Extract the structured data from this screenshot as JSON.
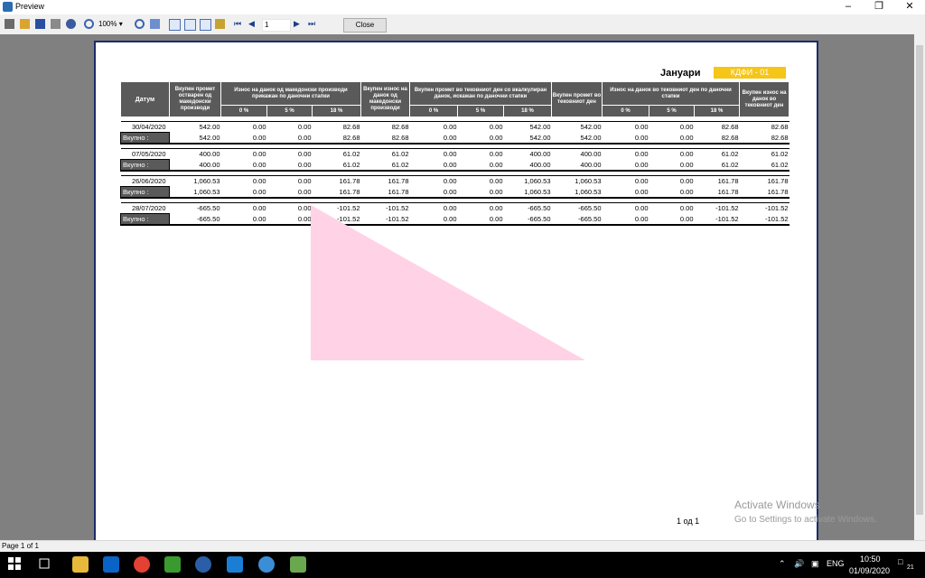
{
  "window": {
    "title": "Preview"
  },
  "toolbar": {
    "zoom": "100%",
    "page_input": "1",
    "close_label": "Close"
  },
  "report": {
    "title": "Јануари",
    "code": "КДФИ - 01",
    "headers": {
      "date": "Датум",
      "total_purchase": "Вкупен промет остварен од македонски производи",
      "vat_mk": "Износ на данок од македонски производи прикажан по даночни стапки",
      "total_tax_mk": "Вкупен износ на данок од македонски производи",
      "turnover_current": "Вкупен промет во тековниот ден со вкалкулиран данок, искажан по даночни стапки",
      "total_current": "Вкупен промет во тековниот ден",
      "vat_current": "Износ на данок во тековниот ден по даночни стапки",
      "total_tax_current": "Вкупен износ на данок во тековниот ден",
      "rate0": "0 %",
      "rate5": "5 %",
      "rate18": "18 %"
    },
    "total_label": "Вкупно :",
    "groups": [
      {
        "date": "30/04/2020",
        "row": [
          "542.00",
          "0.00",
          "0.00",
          "82.68",
          "82.68",
          "0.00",
          "0.00",
          "542.00",
          "542.00",
          "0.00",
          "0.00",
          "82.68",
          "82.68"
        ],
        "total": [
          "542.00",
          "0.00",
          "0.00",
          "82.68",
          "82.68",
          "0.00",
          "0.00",
          "542.00",
          "542.00",
          "0.00",
          "0.00",
          "82.68",
          "82.68"
        ]
      },
      {
        "date": "07/05/2020",
        "row": [
          "400.00",
          "0.00",
          "0.00",
          "61.02",
          "61.02",
          "0.00",
          "0.00",
          "400.00",
          "400.00",
          "0.00",
          "0.00",
          "61.02",
          "61.02"
        ],
        "total": [
          "400.00",
          "0.00",
          "0.00",
          "61.02",
          "61.02",
          "0.00",
          "0.00",
          "400.00",
          "400.00",
          "0.00",
          "0.00",
          "61.02",
          "61.02"
        ]
      },
      {
        "date": "26/06/2020",
        "row": [
          "1,060.53",
          "0.00",
          "0.00",
          "161.78",
          "161.78",
          "0.00",
          "0.00",
          "1,060.53",
          "1,060.53",
          "0.00",
          "0.00",
          "161.78",
          "161.78"
        ],
        "total": [
          "1,060.53",
          "0.00",
          "0.00",
          "161.78",
          "161.78",
          "0.00",
          "0.00",
          "1,060.53",
          "1,060.53",
          "0.00",
          "0.00",
          "161.78",
          "161.78"
        ]
      },
      {
        "date": "28/07/2020",
        "row": [
          "-665.50",
          "0.00",
          "0.00",
          "-101.52",
          "-101.52",
          "0.00",
          "0.00",
          "-665.50",
          "-665.50",
          "0.00",
          "0.00",
          "-101.52",
          "-101.52"
        ],
        "total": [
          "-665.50",
          "0.00",
          "0.00",
          "-101.52",
          "-101.52",
          "0.00",
          "0.00",
          "-665.50",
          "-665.50",
          "0.00",
          "0.00",
          "-101.52",
          "-101.52"
        ]
      }
    ],
    "page_number": "1 од 1"
  },
  "watermark": {
    "line1": "Activate Windows",
    "line2": "Go to Settings to activate Windows."
  },
  "status": {
    "text": "Page 1 of 1"
  },
  "taskbar": {
    "lang": "ENG",
    "time": "10:50",
    "date": "01/09/2020",
    "notifications": "21"
  },
  "colors": {
    "accent": "#f5c518",
    "header_bg": "#5a5a5a",
    "page_border": "#1c2b6b"
  }
}
